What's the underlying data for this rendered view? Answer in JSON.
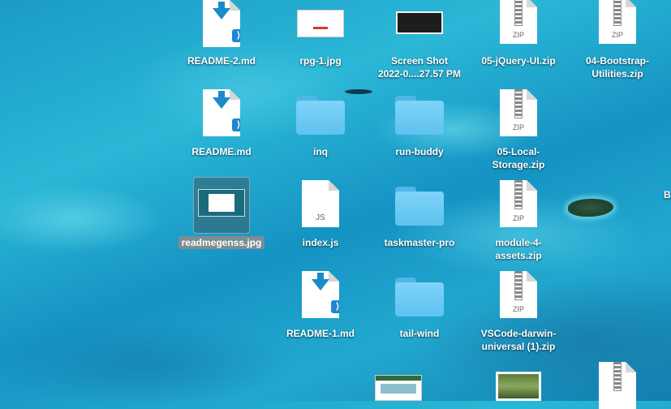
{
  "desktop": {
    "items": [
      {
        "label": "README-2.md",
        "ext": ""
      },
      {
        "label": "rpg-1.jpg",
        "ext": ""
      },
      {
        "label": "Screen Shot\n2022-0....27.57 PM",
        "ext": ""
      },
      {
        "label": "05-jQuery-UI.zip",
        "ext": "ZIP"
      },
      {
        "label": "04-Bootstrap-\nUtilities.zip",
        "ext": "ZIP"
      },
      {
        "label": "README.md",
        "ext": ""
      },
      {
        "label": "inq",
        "ext": ""
      },
      {
        "label": "run-buddy",
        "ext": ""
      },
      {
        "label": "05-Local-\nStorage.zip",
        "ext": "ZIP"
      },
      {
        "label": "readmegenss.jpg",
        "ext": ""
      },
      {
        "label": "index.js",
        "ext": "JS"
      },
      {
        "label": "taskmaster-pro",
        "ext": ""
      },
      {
        "label": "module-4-\nassets.zip",
        "ext": "ZIP"
      },
      {
        "label": "README-1.md",
        "ext": ""
      },
      {
        "label": "tail-wind",
        "ext": ""
      },
      {
        "label": "VSCode-darwin-\nuniversal (1).zip",
        "ext": "ZIP"
      },
      {
        "label": "B",
        "ext": ""
      }
    ]
  },
  "colors": {
    "ocean": "#1a9bc7",
    "folder": "#6ccaf5",
    "selection": "#7c8d93"
  }
}
